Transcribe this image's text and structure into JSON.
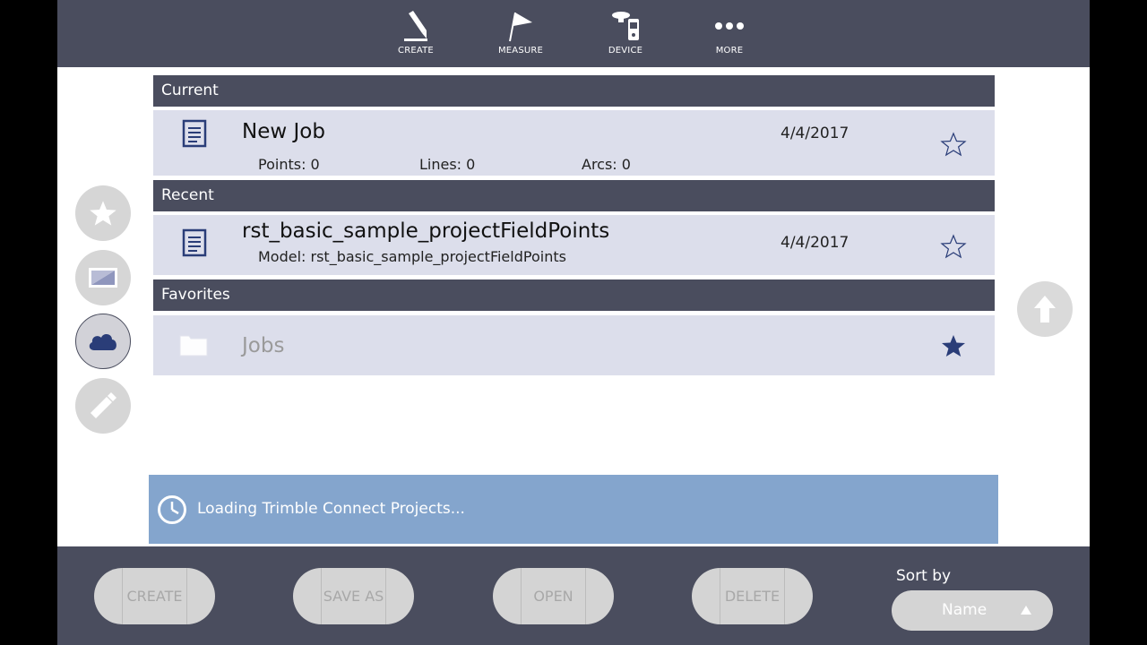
{
  "toolbar": {
    "items": [
      {
        "label": "CREATE",
        "icon": "pencil-icon"
      },
      {
        "label": "MEASURE",
        "icon": "flag-icon"
      },
      {
        "label": "DEVICE",
        "icon": "gnss-receiver-icon"
      },
      {
        "label": "MORE",
        "icon": "more-dots-icon"
      }
    ]
  },
  "sections": {
    "current": {
      "header": "Current",
      "job": {
        "title": "New Job",
        "date": "4/4/2017",
        "points": "Points: 0",
        "lines": "Lines: 0",
        "arcs": "Arcs: 0",
        "favorite": false
      }
    },
    "recent": {
      "header": "Recent",
      "job": {
        "title": "rst_basic_sample_projectFieldPoints",
        "date": "4/4/2017",
        "model": "Model: rst_basic_sample_projectFieldPoints",
        "favorite": false
      }
    },
    "favorites": {
      "header": "Favorites",
      "folder": {
        "title": "Jobs",
        "favorite": true
      }
    }
  },
  "left_rail": {
    "items": [
      "favorites-filter",
      "local-storage",
      "cloud-storage",
      "usb-storage"
    ],
    "active": "cloud-storage"
  },
  "status": {
    "loading_text": "Loading Trimble Connect Projects..."
  },
  "bottom": {
    "create_label": "CREATE",
    "save_as_label": "SAVE AS",
    "open_label": "OPEN",
    "delete_label": "DELETE",
    "sort_label": "Sort by",
    "sort_value": "Name"
  },
  "colors": {
    "bar": "#4a4d5e",
    "row": "#dcdeeb",
    "accent": "#2a3d78",
    "loading": "#84a5cd"
  }
}
